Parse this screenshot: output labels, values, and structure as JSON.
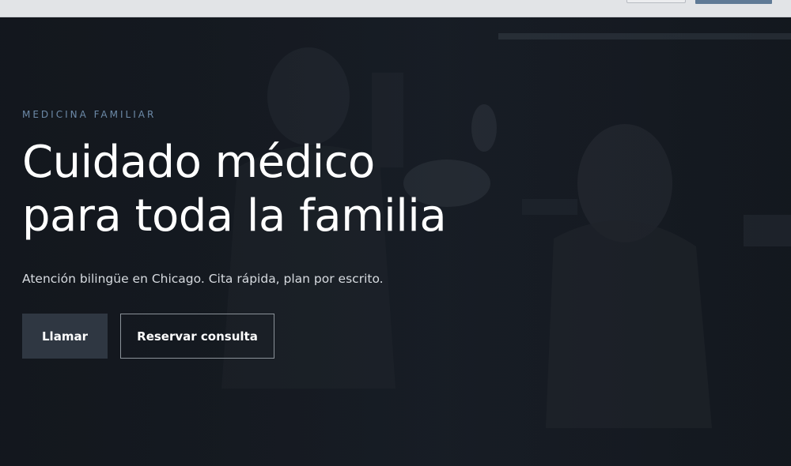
{
  "hero": {
    "eyebrow": "MEDICINA FAMILIAR",
    "headline_line1": "Cuidado médico",
    "headline_line2": "para toda la familia",
    "subhead": "Atención bilingüe en Chicago. Cita rápida, plan por escrito.",
    "buttons": {
      "call_label": "Llamar",
      "book_label": "Reservar consulta"
    }
  },
  "colors": {
    "background": "#161b22",
    "accent": "#6d8aa8",
    "primary_button": "#2f3742",
    "topbar": "#e2e4e7",
    "topbar_button": "#5f7a96"
  }
}
